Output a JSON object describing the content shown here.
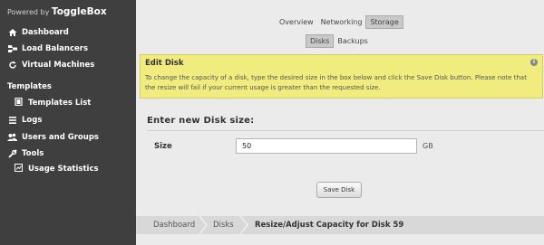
{
  "brand": {
    "prefix": "Powered by",
    "name": "ToggleBox"
  },
  "sidebar": {
    "items": [
      {
        "label": "Dashboard",
        "icon": "home-icon"
      },
      {
        "label": "Load Balancers",
        "icon": "load-balancer-icon"
      },
      {
        "label": "Virtual Machines",
        "icon": "refresh-icon"
      }
    ],
    "templates_section": "Templates",
    "templates_list": "Templates List",
    "items2": [
      {
        "label": "Logs",
        "icon": "logs-icon"
      },
      {
        "label": "Users and Groups",
        "icon": "users-icon"
      },
      {
        "label": "Tools",
        "icon": "wrench-icon"
      }
    ],
    "usage_statistics": "Usage Statistics"
  },
  "tabs": [
    "Overview",
    "Networking",
    "Storage"
  ],
  "active_tab": "Storage",
  "subtabs": [
    "Disks",
    "Backups"
  ],
  "active_subtab": "Disks",
  "alert": {
    "title": "Edit Disk",
    "text": "To change the capacity of a disk, type the desired size in the box below and click the Save Disk button. Please note that the resize will fail if your current usage is greater than the requested size."
  },
  "form": {
    "section_title": "Enter new Disk size:",
    "size_label": "Size",
    "size_value": "50",
    "unit": "GB",
    "save_button": "Save Disk"
  },
  "breadcrumb": [
    "Dashboard",
    "Disks",
    "Resize/Adjust Capacity for Disk 59"
  ],
  "colors": {
    "sidebar_bg": "#3f3f3f",
    "alert_bg": "#f1ec7e",
    "main_bg": "#ebebeb"
  }
}
